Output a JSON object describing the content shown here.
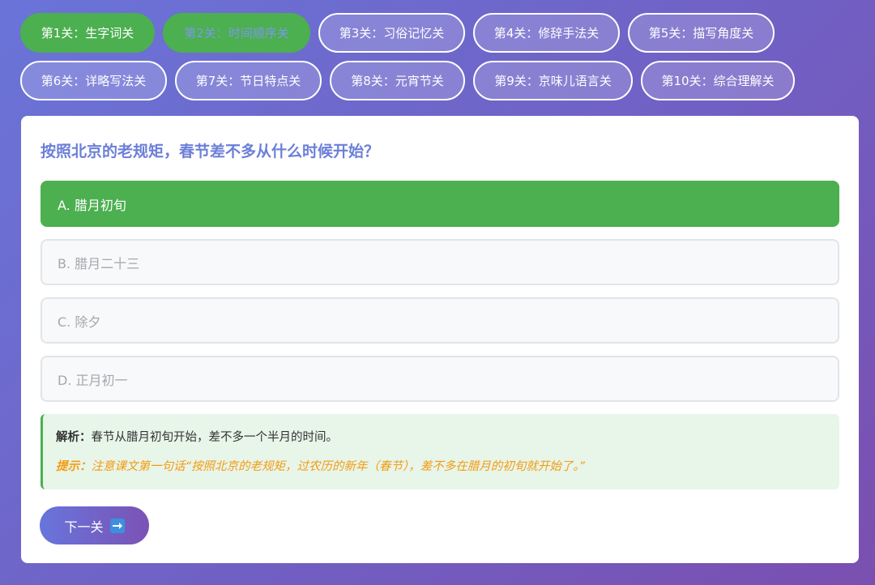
{
  "levels": [
    {
      "label": "第1关：生字词关",
      "state": "done"
    },
    {
      "label": "第2关：时间顺序关",
      "state": "current"
    },
    {
      "label": "第3关：习俗记忆关",
      "state": "normal"
    },
    {
      "label": "第4关：修辞手法关",
      "state": "normal"
    },
    {
      "label": "第5关：描写角度关",
      "state": "normal"
    },
    {
      "label": "第6关：详略写法关",
      "state": "normal"
    },
    {
      "label": "第7关：节日特点关",
      "state": "normal"
    },
    {
      "label": "第8关：元宵节关",
      "state": "normal"
    },
    {
      "label": "第9关：京味儿语言关",
      "state": "normal"
    },
    {
      "label": "第10关：综合理解关",
      "state": "normal"
    }
  ],
  "question": {
    "text": "按照北京的老规矩，春节差不多从什么时候开始？",
    "options": [
      {
        "label": "A. 腊月初旬",
        "selected": true
      },
      {
        "label": "B. 腊月二十三",
        "selected": false
      },
      {
        "label": "C. 除夕",
        "selected": false
      },
      {
        "label": "D. 正月初一",
        "selected": false
      }
    ]
  },
  "explanation": {
    "label": "解析：",
    "text": "春节从腊月初旬开始，差不多一个半月的时间。",
    "hint_label": "提示：",
    "hint_text": "注意课文第一句话“按照北京的老规矩，过农历的新年（春节），差不多在腊月的初旬就开始了。”"
  },
  "next_button": {
    "label": "下一关",
    "icon": "right-arrow-icon"
  },
  "colors": {
    "accent_green": "#4caf50",
    "question_blue": "#6c7fd8",
    "hint_orange": "#f39c12"
  }
}
